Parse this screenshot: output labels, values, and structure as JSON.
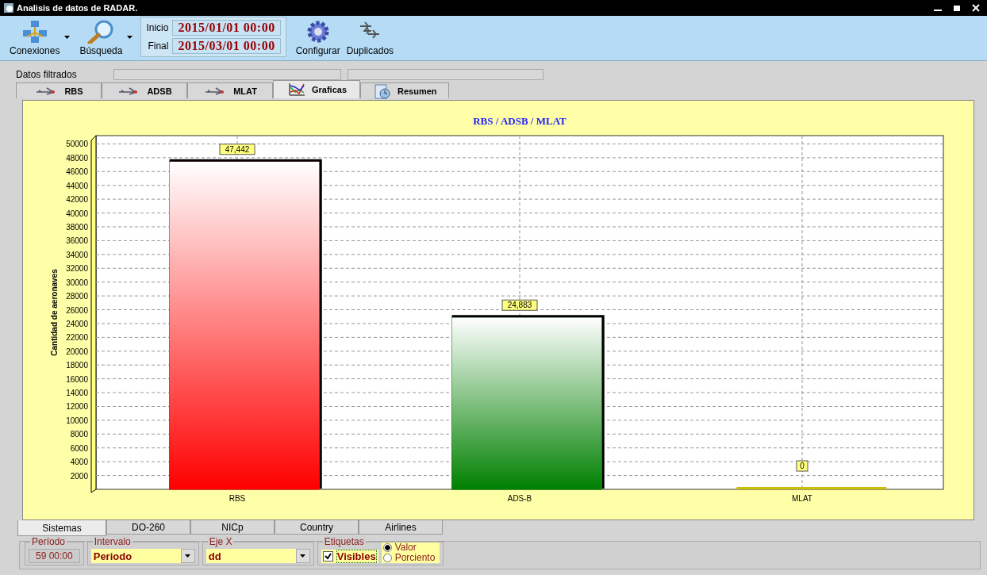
{
  "window": {
    "title": "Analisis de datos de RADAR."
  },
  "toolbar": {
    "items": [
      {
        "kind": "network",
        "label": "Conexiones",
        "dropdown": true
      },
      {
        "kind": "search",
        "label": "Búsqueda",
        "dropdown": true
      },
      {
        "kind": "dates",
        "fields": [
          {
            "label": "Inicio",
            "value": "2015/01/01 00:00"
          },
          {
            "label": "Final",
            "value": "2015/03/01 00:00"
          }
        ]
      },
      {
        "kind": "gear",
        "label": "Configurar",
        "dropdown": false
      },
      {
        "kind": "planes",
        "label": "Duplicados",
        "dropdown": false
      }
    ]
  },
  "filter": {
    "label": "Datos filtrados"
  },
  "tabs": [
    {
      "kind": "sensor",
      "label": "RBS",
      "selected": false
    },
    {
      "kind": "sensor",
      "label": "ADSB",
      "selected": false
    },
    {
      "kind": "sensor",
      "label": "MLAT",
      "selected": false
    },
    {
      "kind": "chart",
      "label": "Graficas",
      "selected": true
    },
    {
      "kind": "summary",
      "label": "Resumen",
      "selected": false
    }
  ],
  "chart": {
    "chart_data": {
      "type": "bar",
      "title": "RBS / ADSB / MLAT",
      "ylabel": "Cantidad de aeronaves",
      "categories": [
        "RBS",
        "ADS-B",
        "MLAT"
      ],
      "series": [
        {
          "color": "#ff0000",
          "values": [
            47442,
            null,
            null
          ]
        },
        {
          "color": "#008000",
          "values": [
            null,
            24883,
            null
          ]
        },
        {
          "color": "#c8c000",
          "values": [
            null,
            null,
            0
          ]
        }
      ],
      "value_labels": [
        "47,442",
        "24,883",
        "0"
      ],
      "grid": true,
      "ylim": [
        0,
        51200
      ],
      "yticks": [
        2000,
        4000,
        6000,
        8000,
        10000,
        12000,
        14000,
        16000,
        18000,
        20000,
        22000,
        24000,
        26000,
        28000,
        30000,
        32000,
        34000,
        36000,
        38000,
        40000,
        42000,
        44000,
        46000,
        48000,
        50000
      ]
    }
  },
  "bottom_tabs": [
    {
      "label": "Sistemas",
      "selected": true
    },
    {
      "label": "DO-260",
      "selected": false
    },
    {
      "label": "NICp",
      "selected": false
    },
    {
      "label": "Country",
      "selected": false
    },
    {
      "label": "Airlines",
      "selected": false
    }
  ],
  "options": {
    "periodo": {
      "legend": "Período",
      "value": "59 00:00"
    },
    "intervalo": {
      "legend": "Intervalo",
      "value": "Periodo"
    },
    "eje_x": {
      "legend": "Eje X",
      "value": "dd"
    },
    "etiquetas": {
      "legend": "Etiquetas",
      "visible": {
        "label": "Visibles",
        "checked": true
      },
      "modes": [
        {
          "label": "Valor",
          "selected": true
        },
        {
          "label": "Porciento",
          "selected": false
        }
      ]
    }
  }
}
